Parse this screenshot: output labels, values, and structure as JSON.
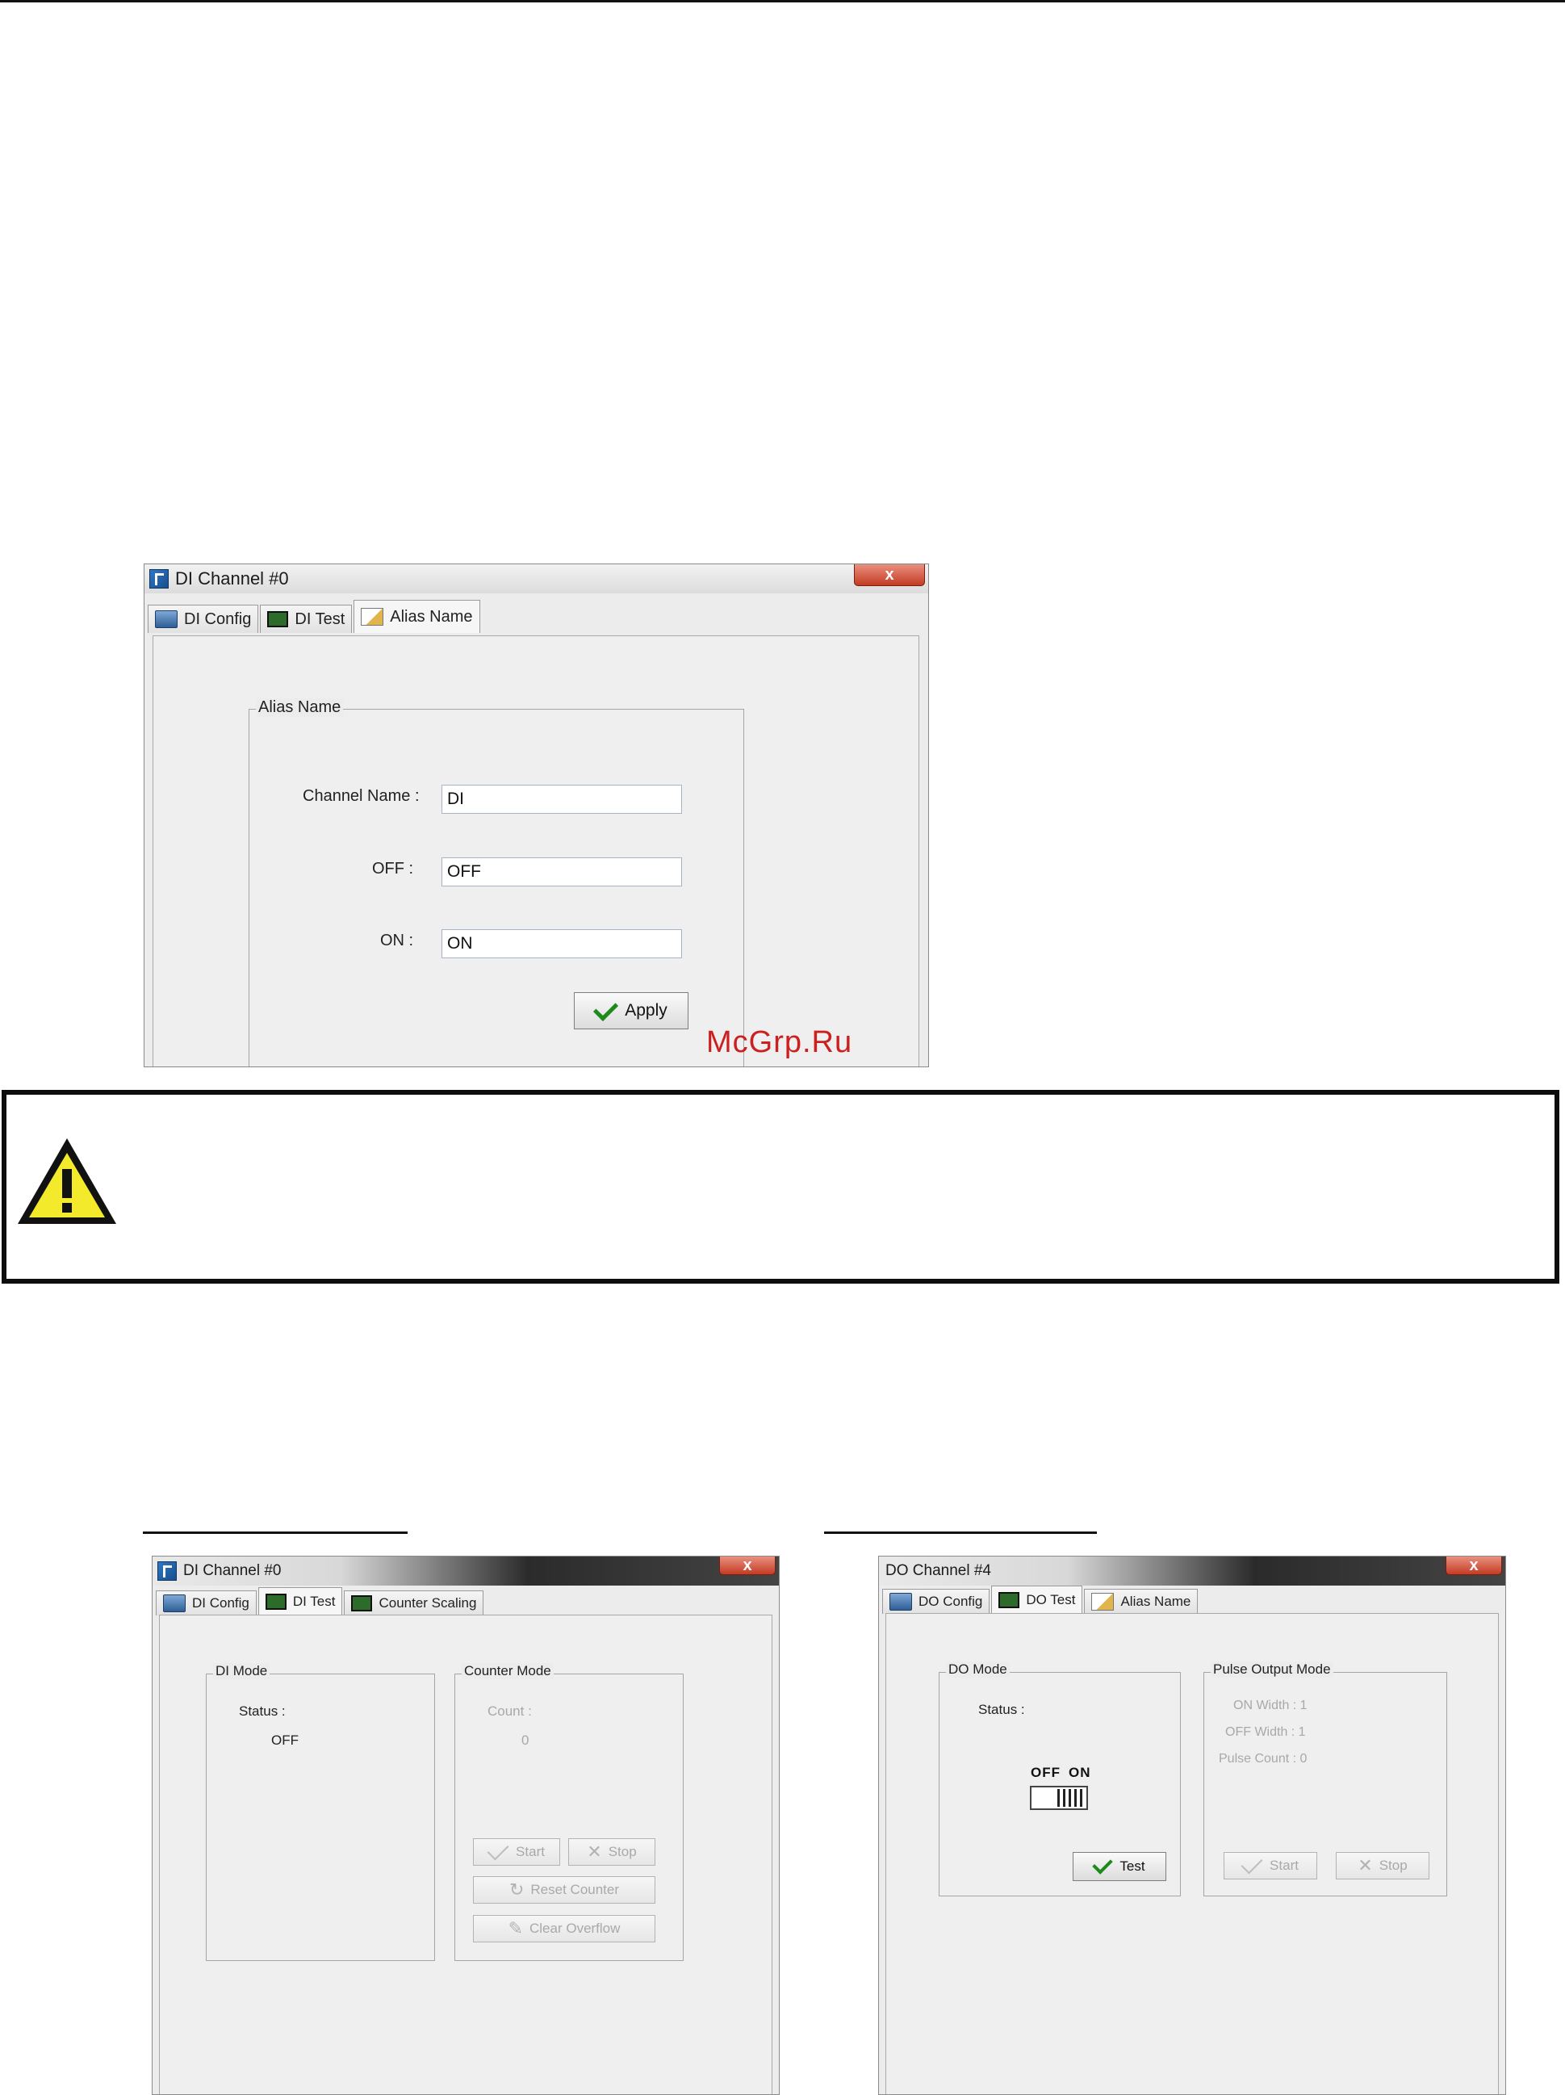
{
  "watermark": "McGrp.Ru",
  "dialog_alias": {
    "title": "DI Channel #0",
    "close": "x",
    "tabs": [
      {
        "label": "DI Config",
        "icon": "config-icon"
      },
      {
        "label": "DI Test",
        "icon": "test-icon"
      },
      {
        "label": "Alias Name",
        "icon": "alias-icon"
      }
    ],
    "group_title": "Alias Name",
    "fields": [
      {
        "label": "Channel Name :",
        "value": "DI"
      },
      {
        "label": "OFF :",
        "value": "OFF"
      },
      {
        "label": "ON :",
        "value": "ON"
      }
    ],
    "apply_label": "Apply"
  },
  "dialog_di_test": {
    "title": "DI Channel #0",
    "close": "x",
    "tabs": [
      {
        "label": "DI Config"
      },
      {
        "label": "DI Test"
      },
      {
        "label": "Counter Scaling"
      }
    ],
    "di_mode": {
      "title": "DI Mode",
      "status_label": "Status :",
      "status_value": "OFF"
    },
    "counter_mode": {
      "title": "Counter Mode",
      "count_label": "Count :",
      "count_value": "0",
      "start": "Start",
      "stop": "Stop",
      "reset": "Reset Counter",
      "clear": "Clear Overflow"
    }
  },
  "dialog_do_test": {
    "title": "DO Channel #4",
    "close": "x",
    "tabs": [
      {
        "label": "DO Config"
      },
      {
        "label": "DO Test"
      },
      {
        "label": "Alias Name"
      }
    ],
    "do_mode": {
      "title": "DO Mode",
      "status_label": "Status :",
      "off": "OFF",
      "on": "ON",
      "test": "Test"
    },
    "pulse_mode": {
      "title": "Pulse Output Mode",
      "on_width": "ON Width : 1",
      "off_width": "OFF Width : 1",
      "pulse_count": "Pulse Count : 0",
      "start": "Start",
      "stop": "Stop"
    }
  }
}
